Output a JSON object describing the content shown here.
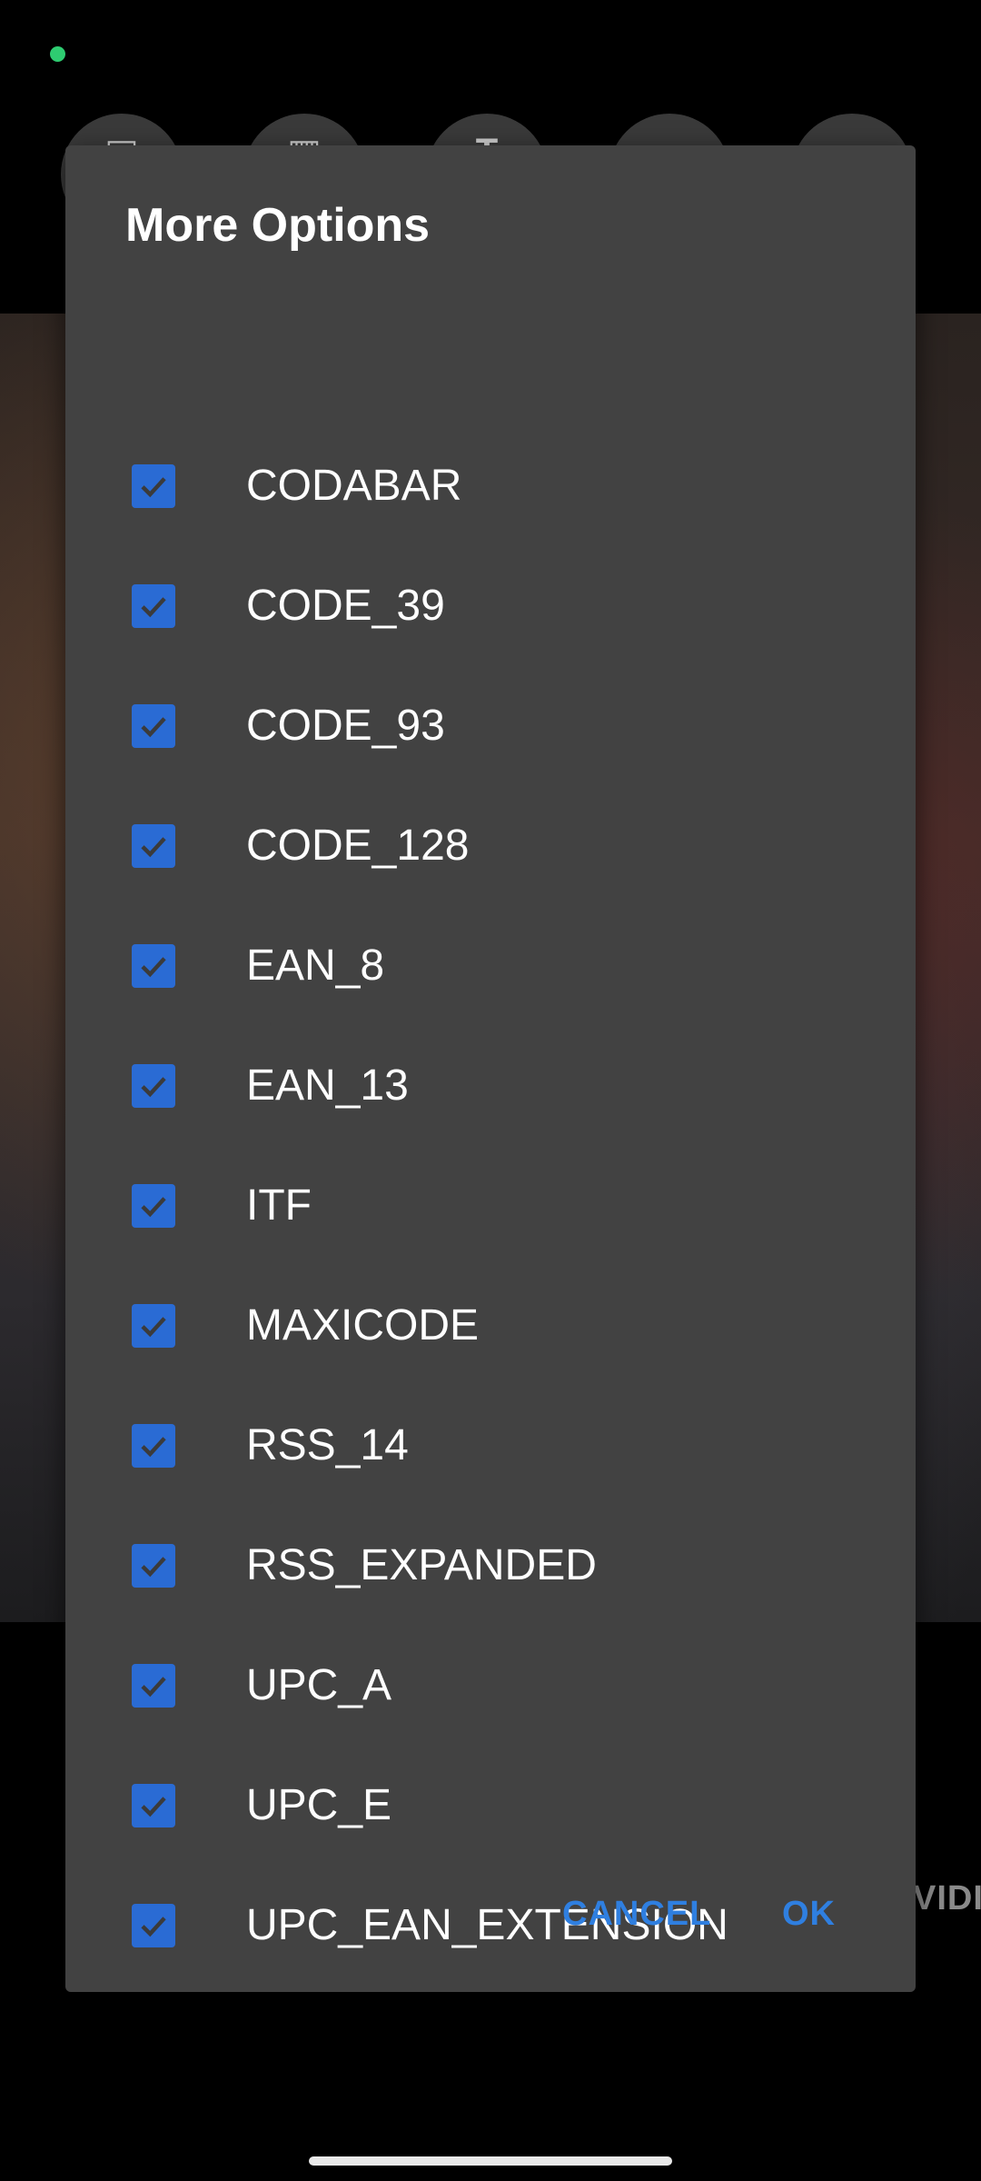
{
  "camera": {
    "partial_text": "VIDI"
  },
  "dialog": {
    "title": "More Options",
    "options": [
      {
        "label": "CODABAR",
        "checked": true
      },
      {
        "label": "CODE_39",
        "checked": true
      },
      {
        "label": "CODE_93",
        "checked": true
      },
      {
        "label": "CODE_128",
        "checked": true
      },
      {
        "label": "EAN_8",
        "checked": true
      },
      {
        "label": "EAN_13",
        "checked": true
      },
      {
        "label": "ITF",
        "checked": true
      },
      {
        "label": "MAXICODE",
        "checked": true
      },
      {
        "label": "RSS_14",
        "checked": true
      },
      {
        "label": "RSS_EXPANDED",
        "checked": true
      },
      {
        "label": "UPC_A",
        "checked": true
      },
      {
        "label": "UPC_E",
        "checked": true
      },
      {
        "label": "UPC_EAN_EXTENSION",
        "checked": true
      }
    ],
    "cancel_label": "CANCEL",
    "ok_label": "OK"
  },
  "colors": {
    "dialog_bg": "#424242",
    "checkbox_blue": "#2a6bd4",
    "accent_blue": "#2f7fe0",
    "status_green": "#2ecc71"
  }
}
